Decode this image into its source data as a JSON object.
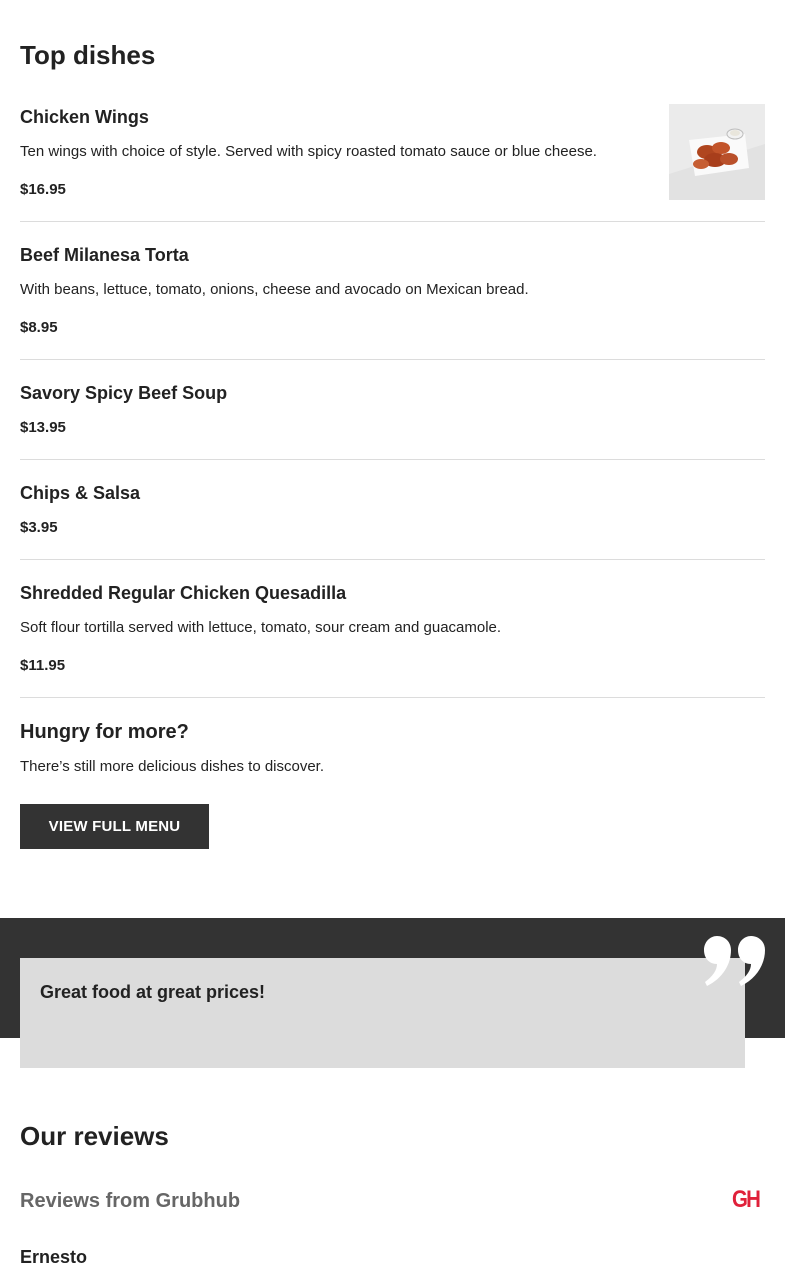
{
  "top_dishes": {
    "title": "Top dishes",
    "items": [
      {
        "name": "Chicken Wings",
        "description": "Ten wings with choice of style. Served with spicy roasted tomato sauce or blue cheese.",
        "price": "$16.95",
        "photo": "chicken-wings-photo"
      },
      {
        "name": "Beef Milanesa Torta",
        "description": "With beans, lettuce, tomato, onions, cheese and avocado on Mexican bread.",
        "price": "$8.95"
      },
      {
        "name": "Savory Spicy Beef Soup",
        "description": "",
        "price": "$13.95"
      },
      {
        "name": "Chips & Salsa",
        "description": "",
        "price": "$3.95"
      },
      {
        "name": "Shredded Regular Chicken Quesadilla",
        "description": "Soft flour tortilla served with lettuce, tomato, sour cream and guacamole.",
        "price": "$11.95"
      }
    ]
  },
  "more": {
    "title": "Hungry for more?",
    "text": "There’s still more delicious dishes to discover.",
    "button_label": "VIEW FULL MENU"
  },
  "testimonial": {
    "quote": "Great food at great prices!",
    "icon": "quote-mark-icon"
  },
  "reviews": {
    "title": "Our reviews",
    "source": "Reviews from Grubhub",
    "logo_text": "GH",
    "first_reviewer": "Ernesto"
  },
  "colors": {
    "dark": "#333333",
    "card": "#dcdcdc",
    "divider": "#dcdcdc",
    "grubhub_red": "#e0213a",
    "text": "#222222",
    "muted": "#666666"
  }
}
